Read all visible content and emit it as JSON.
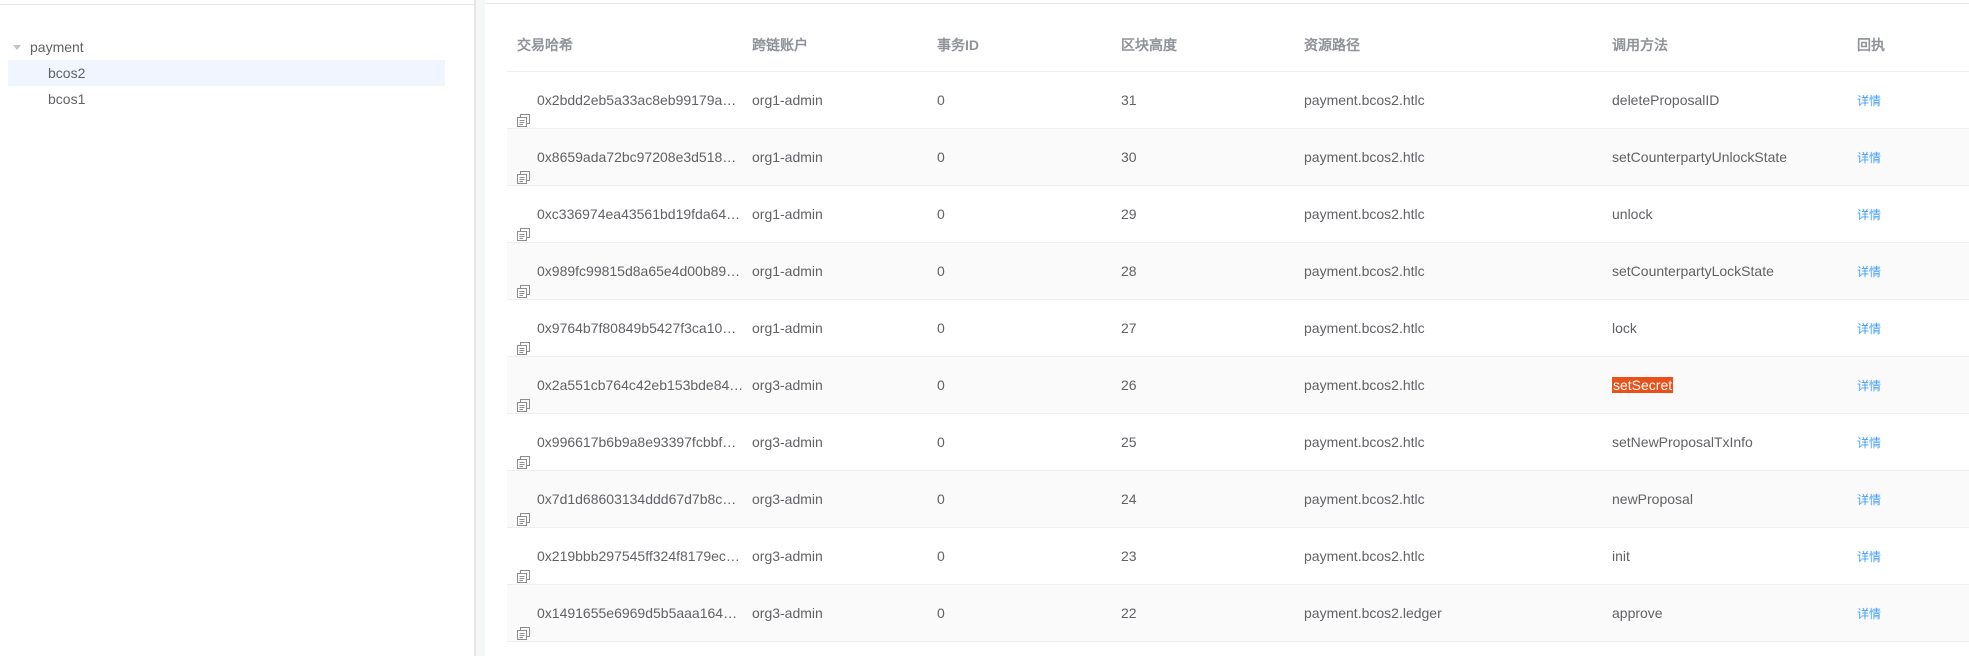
{
  "sidebar": {
    "tree": {
      "root_label": "payment",
      "children": [
        {
          "label": "bcos2"
        },
        {
          "label": "bcos1"
        }
      ]
    }
  },
  "table": {
    "headers": {
      "hash": "交易哈希",
      "account": "跨链账户",
      "tx_id": "事务ID",
      "block": "区块高度",
      "path": "资源路径",
      "method": "调用方法",
      "receipt": "回执"
    },
    "detail_label": "详情",
    "rows": [
      {
        "hash": "0x2bdd2eb5a33ac8eb99179a…",
        "account": "org1-admin",
        "tx_id": "0",
        "block": "31",
        "path": "payment.bcos2.htlc",
        "method": "deleteProposalID"
      },
      {
        "hash": "0x8659ada72bc97208e3d518d…",
        "account": "org1-admin",
        "tx_id": "0",
        "block": "30",
        "path": "payment.bcos2.htlc",
        "method": "setCounterpartyUnlockState"
      },
      {
        "hash": "0xc336974ea43561bd19fda64…",
        "account": "org1-admin",
        "tx_id": "0",
        "block": "29",
        "path": "payment.bcos2.htlc",
        "method": "unlock"
      },
      {
        "hash": "0x989fc99815d8a65e4d00b89…",
        "account": "org1-admin",
        "tx_id": "0",
        "block": "28",
        "path": "payment.bcos2.htlc",
        "method": "setCounterpartyLockState"
      },
      {
        "hash": "0x9764b7f80849b5427f3ca10…",
        "account": "org1-admin",
        "tx_id": "0",
        "block": "27",
        "path": "payment.bcos2.htlc",
        "method": "lock"
      },
      {
        "hash": "0x2a551cb764c42eb153bde84…",
        "account": "org3-admin",
        "tx_id": "0",
        "block": "26",
        "path": "payment.bcos2.htlc",
        "method": "setSecret"
      },
      {
        "hash": "0x996617b6b9a8e93397fcbbf6…",
        "account": "org3-admin",
        "tx_id": "0",
        "block": "25",
        "path": "payment.bcos2.htlc",
        "method": "setNewProposalTxInfo"
      },
      {
        "hash": "0x7d1d68603134ddd67d7b8c…",
        "account": "org3-admin",
        "tx_id": "0",
        "block": "24",
        "path": "payment.bcos2.htlc",
        "method": "newProposal"
      },
      {
        "hash": "0x219bbb297545ff324f8179ec…",
        "account": "org3-admin",
        "tx_id": "0",
        "block": "23",
        "path": "payment.bcos2.htlc",
        "method": "init"
      },
      {
        "hash": "0x1491655e6969d5b5aaa164…",
        "account": "org3-admin",
        "tx_id": "0",
        "block": "22",
        "path": "payment.bcos2.ledger",
        "method": "approve"
      }
    ]
  },
  "colors": {
    "link": "#409eff",
    "highlight": "#e8511a",
    "selected_row": "#f0f5ff",
    "stripe": "#fafafa"
  },
  "icons": {
    "copy": "copy-icon",
    "caret": "caret-down-icon"
  }
}
